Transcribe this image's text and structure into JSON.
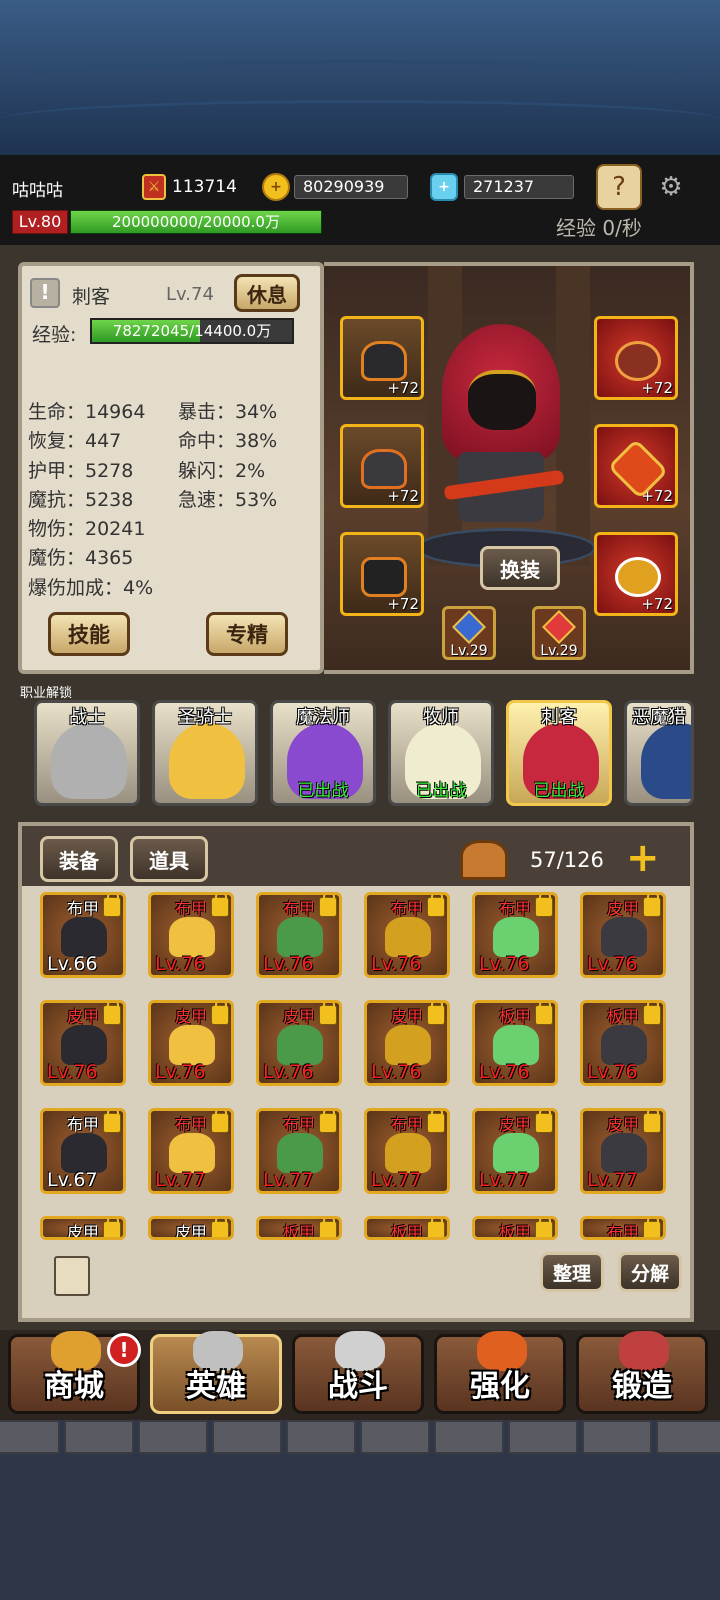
{
  "player": {
    "name": "咕咕咕",
    "level": "Lv.80",
    "exp": "200000000/20000.0万",
    "exp_fill": 1.0,
    "exp_rate": "经验 0/秒"
  },
  "resources": {
    "power": "113714",
    "gold": "80290939",
    "gems": "271237"
  },
  "hero": {
    "class": "刺客",
    "level": "Lv.74",
    "rest_label": "休息",
    "exp_label": "经验:",
    "exp": "78272045/14400.0万",
    "exp_fill": 0.54,
    "stats_left": [
      "生命：14964",
      "恢复：447",
      "护甲：5278",
      "魔抗：5238",
      "物伤：20241",
      "魔伤：4365",
      "爆伤加成：4%"
    ],
    "stats_right": [
      "暴击：34%",
      "命中：38%",
      "躲闪：2%",
      "急速：53%"
    ],
    "skill_label": "技能",
    "spec_label": "专精",
    "change_label": "换装",
    "gear_plus": "+72",
    "gem_levels": [
      "Lv.29",
      "Lv.29"
    ]
  },
  "class_unlock": {
    "title": "职业解锁",
    "classes": [
      {
        "name": "战士",
        "status": ""
      },
      {
        "name": "圣骑士",
        "status": ""
      },
      {
        "name": "魔法师",
        "status": "已出战"
      },
      {
        "name": "牧师",
        "status": "已出战"
      },
      {
        "name": "刺客",
        "status": "已出战"
      },
      {
        "name": "恶魔猎",
        "status": ""
      }
    ]
  },
  "inventory": {
    "tabs": [
      "装备",
      "道具"
    ],
    "capacity": "57/126",
    "sort_label": "整理",
    "decompose_label": "分解",
    "rows": [
      [
        {
          "t": "布甲",
          "l": "Lv.66",
          "r": false
        },
        {
          "t": "布甲",
          "l": "Lv.76",
          "r": true
        },
        {
          "t": "布甲",
          "l": "Lv.76",
          "r": true
        },
        {
          "t": "布甲",
          "l": "Lv.76",
          "r": true
        },
        {
          "t": "布甲",
          "l": "Lv.76",
          "r": true
        },
        {
          "t": "皮甲",
          "l": "Lv.76",
          "r": true
        }
      ],
      [
        {
          "t": "皮甲",
          "l": "Lv.76",
          "r": true
        },
        {
          "t": "皮甲",
          "l": "Lv.76",
          "r": true
        },
        {
          "t": "皮甲",
          "l": "Lv.76",
          "r": true
        },
        {
          "t": "皮甲",
          "l": "Lv.76",
          "r": true
        },
        {
          "t": "板甲",
          "l": "Lv.76",
          "r": true
        },
        {
          "t": "板甲",
          "l": "Lv.76",
          "r": true
        }
      ],
      [
        {
          "t": "布甲",
          "l": "Lv.67",
          "r": false
        },
        {
          "t": "布甲",
          "l": "Lv.77",
          "r": true
        },
        {
          "t": "布甲",
          "l": "Lv.77",
          "r": true
        },
        {
          "t": "布甲",
          "l": "Lv.77",
          "r": true
        },
        {
          "t": "皮甲",
          "l": "Lv.77",
          "r": true
        },
        {
          "t": "皮甲",
          "l": "Lv.77",
          "r": true
        }
      ],
      [
        {
          "t": "皮甲",
          "l": "",
          "r": false
        },
        {
          "t": "皮甲",
          "l": "",
          "r": false
        },
        {
          "t": "板甲",
          "l": "",
          "r": true
        },
        {
          "t": "板甲",
          "l": "",
          "r": true
        },
        {
          "t": "板甲",
          "l": "",
          "r": true
        },
        {
          "t": "布甲",
          "l": "",
          "r": true
        }
      ]
    ]
  },
  "nav": {
    "items": [
      "商城",
      "英雄",
      "战斗",
      "强化",
      "锻造"
    ],
    "selected": 1,
    "badge": "!"
  },
  "colors": {
    "accent": "#f3b418",
    "exp_green": "#4ab83a",
    "level_red": "#b02020",
    "panel": "#e4dccb"
  }
}
